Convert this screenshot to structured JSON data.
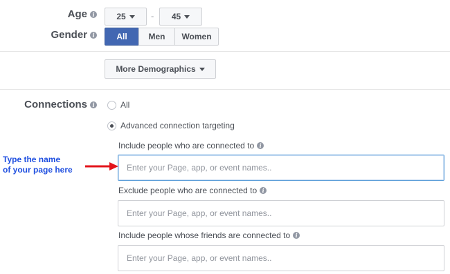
{
  "demographics": {
    "age": {
      "label": "Age",
      "min": "25",
      "max": "45",
      "separator": "-"
    },
    "gender": {
      "label": "Gender",
      "options": [
        "All",
        "Men",
        "Women"
      ],
      "selected": "All"
    },
    "more_button": "More Demographics"
  },
  "connections": {
    "label": "Connections",
    "options": [
      "All",
      "Advanced connection targeting"
    ],
    "selected": "Advanced connection targeting",
    "include_label": "Include people who are connected to",
    "include_placeholder": "Enter your Page, app, or event names..",
    "exclude_label": "Exclude people who are connected to",
    "exclude_placeholder": "Enter your Page, app, or event names..",
    "friends_label": "Include people whose friends are connected to",
    "friends_placeholder": "Enter your Page, app, or event names.."
  },
  "annotation": {
    "line1": "Type the name",
    "line2": "of your page here",
    "color": "#1f4fe0",
    "arrow_color": "#e3141b"
  },
  "colors": {
    "active_segment": "#4267b2",
    "focus_border": "#5b9dd9"
  }
}
